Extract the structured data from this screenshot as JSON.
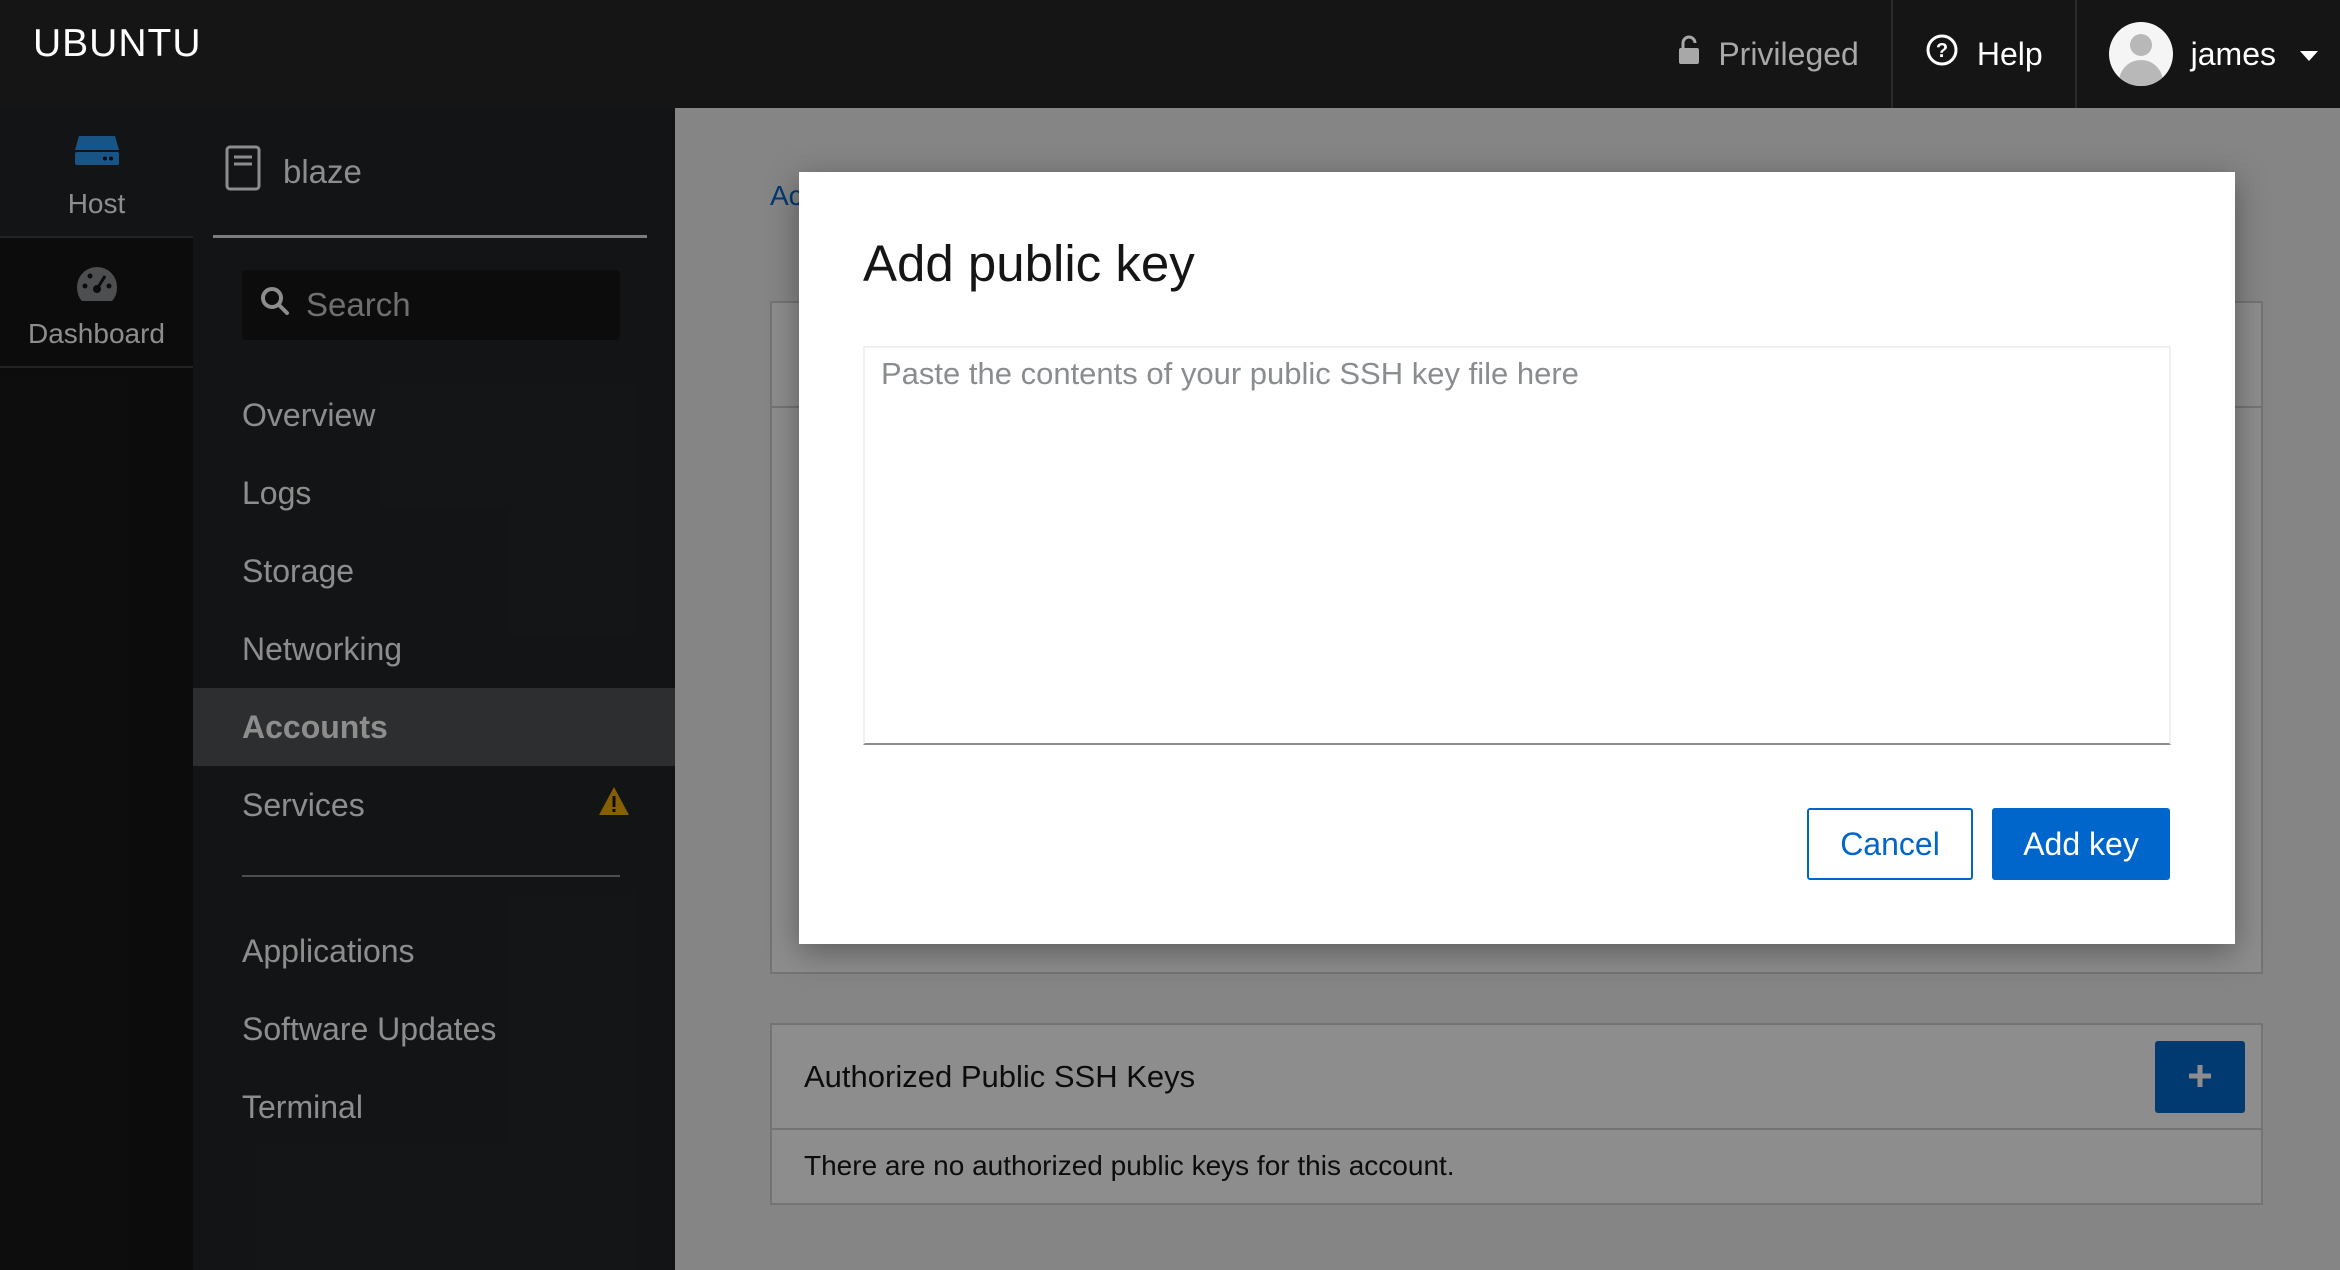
{
  "topbar": {
    "brand": "UBUNTU",
    "privileged_label": "Privileged",
    "help_label": "Help",
    "user_name": "james"
  },
  "rail": {
    "items": [
      {
        "label": "Host",
        "icon": "server-icon",
        "active": true
      },
      {
        "label": "Dashboard",
        "icon": "dashboard-gauge-icon",
        "active": false
      }
    ]
  },
  "nav": {
    "host_name": "blaze",
    "search_placeholder": "Search",
    "items": [
      {
        "label": "Overview"
      },
      {
        "label": "Logs"
      },
      {
        "label": "Storage"
      },
      {
        "label": "Networking"
      },
      {
        "label": "Accounts",
        "active": true
      },
      {
        "label": "Services",
        "warning": true
      }
    ],
    "secondary_items": [
      {
        "label": "Applications"
      },
      {
        "label": "Software Updates"
      },
      {
        "label": "Terminal"
      }
    ]
  },
  "main": {
    "breadcrumb": "Ac",
    "ssh_card": {
      "title": "Authorized Public SSH Keys",
      "empty_text": "There are no authorized public keys for this account."
    }
  },
  "modal": {
    "title": "Add public key",
    "textarea_placeholder": "Paste the contents of your public SSH key file here",
    "cancel_label": "Cancel",
    "add_label": "Add key"
  },
  "colors": {
    "accent": "#0066cc",
    "topbar_bg": "#151515",
    "nav_bg": "#212427",
    "warning": "#f0ab00",
    "rail_icon": "#2b9af3"
  }
}
